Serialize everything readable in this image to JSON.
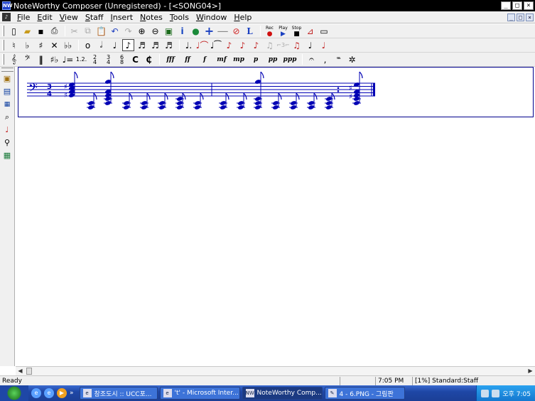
{
  "window": {
    "title": "NoteWorthy Composer (Unregistered) - [<SONG04>]",
    "app_icon": "nwc-icon",
    "controls": [
      "_",
      "□",
      "×"
    ]
  },
  "menubar": {
    "doc_icon": "nwc-doc-icon",
    "items": [
      "File",
      "Edit",
      "View",
      "Staff",
      "Insert",
      "Notes",
      "Tools",
      "Window",
      "Help"
    ],
    "mdi_controls": [
      "_",
      "□",
      "×"
    ]
  },
  "toolbar1": {
    "buttons": [
      "new-icon",
      "open-icon",
      "save-icon",
      "print-icon",
      "cut-icon",
      "copy-icon",
      "paste-icon",
      "undo-icon",
      "redo-icon",
      "zoom-in-icon",
      "zoom-out-icon",
      "audit-icon",
      "info-icon",
      "globe-icon",
      "plus-icon",
      "minus-icon",
      "no-icon",
      "L-icon"
    ],
    "rec_label": "Rec",
    "play_label": "Play",
    "stop_label": "Stop"
  },
  "toolbar3": {
    "dynamics": [
      "fff",
      "ff",
      "f",
      "mf",
      "mp",
      "p",
      "pp",
      "ppp"
    ]
  },
  "statusbar": {
    "status": "Ready",
    "time": "7:05 PM",
    "staff_info": "[1%] Standard:Staff"
  },
  "taskbar": {
    "tasks": [
      {
        "label": "창조도시 :: UCC포...",
        "active": false
      },
      {
        "label": "'t' - Microsoft Inter...",
        "active": false
      },
      {
        "label": "NoteWorthy Comp...",
        "active": true
      },
      {
        "label": "4 - 6.PNG - 그림판",
        "active": false
      }
    ],
    "clock": "오후 7:05"
  },
  "score": {
    "time_signature": [
      "3",
      "4"
    ],
    "staff_color": "#0000b4"
  }
}
